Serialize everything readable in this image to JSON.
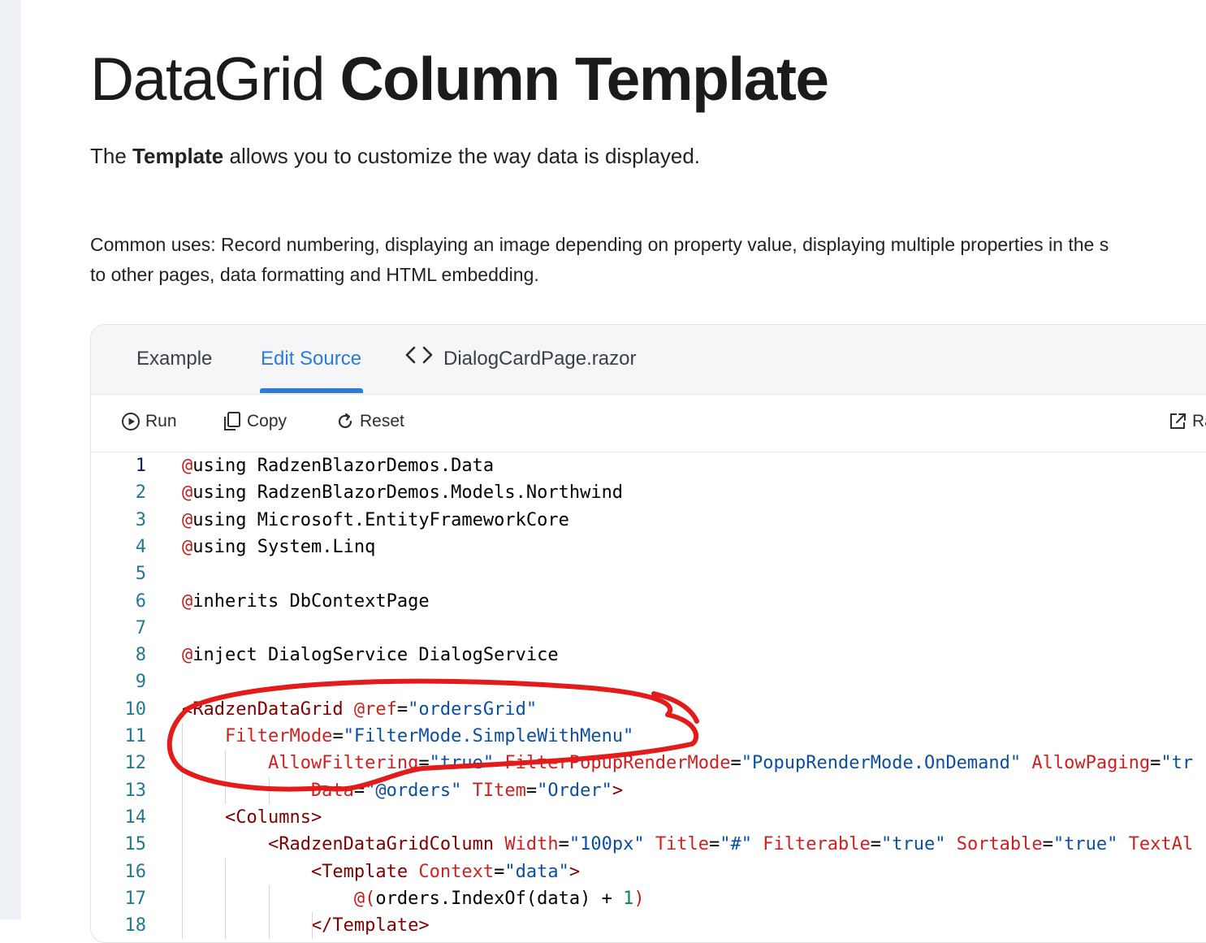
{
  "page": {
    "title_light": "DataGrid",
    "title_bold": "Column Template",
    "intro_before": "The",
    "intro_bold": "Template",
    "intro_after": "allows you to customize the way data is displayed.",
    "uses_line1": "Common uses: Record numbering, displaying an image depending on property value, displaying multiple properties in the s",
    "uses_line2": "to other pages, data formatting and HTML embedding."
  },
  "tabs": {
    "example": "Example",
    "edit_source": "Edit Source",
    "file": "DialogCardPage.razor",
    "active": "edit_source"
  },
  "toolbar": {
    "run": "Run",
    "copy": "Copy",
    "reset": "Reset",
    "external": "Ra"
  },
  "icons": {
    "run": "play-circle-icon",
    "copy": "copy-icon",
    "reset": "refresh-icon",
    "external": "external-link-icon",
    "file": "code-brackets-icon"
  },
  "colors": {
    "accent": "#2f7ad8",
    "annotation": "#e31b1b"
  },
  "code": {
    "lines": [
      {
        "n": "1",
        "tokens": [
          {
            "t": "@",
            "c": "kw"
          },
          {
            "t": "using RadzenBlazorDemos.Data",
            "c": "plain"
          }
        ]
      },
      {
        "n": "2",
        "tokens": [
          {
            "t": "@",
            "c": "kw"
          },
          {
            "t": "using RadzenBlazorDemos.Models.Northwind",
            "c": "plain"
          }
        ]
      },
      {
        "n": "3",
        "tokens": [
          {
            "t": "@",
            "c": "kw"
          },
          {
            "t": "using Microsoft.EntityFrameworkCore",
            "c": "plain"
          }
        ]
      },
      {
        "n": "4",
        "tokens": [
          {
            "t": "@",
            "c": "kw"
          },
          {
            "t": "using System.Linq",
            "c": "plain"
          }
        ]
      },
      {
        "n": "5",
        "tokens": []
      },
      {
        "n": "6",
        "tokens": [
          {
            "t": "@",
            "c": "kw"
          },
          {
            "t": "inherits DbContextPage",
            "c": "plain"
          }
        ]
      },
      {
        "n": "7",
        "tokens": []
      },
      {
        "n": "8",
        "tokens": [
          {
            "t": "@",
            "c": "kw"
          },
          {
            "t": "inject DialogService DialogService",
            "c": "plain"
          }
        ]
      },
      {
        "n": "9",
        "tokens": []
      },
      {
        "n": "10",
        "tokens": [
          {
            "t": "<RadzenDataGrid ",
            "c": "tag"
          },
          {
            "t": "@ref",
            "c": "attr"
          },
          {
            "t": "=",
            "c": "plain"
          },
          {
            "t": "\"ordersGrid\"",
            "c": "str"
          }
        ]
      },
      {
        "n": "11",
        "tokens": [
          {
            "t": "    FilterMode",
            "c": "attr"
          },
          {
            "t": "=",
            "c": "plain"
          },
          {
            "t": "\"FilterMode.SimpleWithMenu\"",
            "c": "str"
          }
        ]
      },
      {
        "n": "12",
        "tokens": [
          {
            "t": "        AllowFiltering",
            "c": "attr"
          },
          {
            "t": "=",
            "c": "plain"
          },
          {
            "t": "\"true\" ",
            "c": "str"
          },
          {
            "t": "FilterPopupRenderMode",
            "c": "attr"
          },
          {
            "t": "=",
            "c": "plain"
          },
          {
            "t": "\"PopupRenderMode.OnDemand\" ",
            "c": "str"
          },
          {
            "t": "AllowPaging",
            "c": "attr"
          },
          {
            "t": "=",
            "c": "plain"
          },
          {
            "t": "\"tr",
            "c": "str"
          }
        ]
      },
      {
        "n": "13",
        "tokens": [
          {
            "t": "            Data",
            "c": "attr"
          },
          {
            "t": "=",
            "c": "plain"
          },
          {
            "t": "\"@orders\" ",
            "c": "str"
          },
          {
            "t": "TItem",
            "c": "attr"
          },
          {
            "t": "=",
            "c": "plain"
          },
          {
            "t": "\"Order\"",
            "c": "str"
          },
          {
            "t": ">",
            "c": "tag"
          }
        ]
      },
      {
        "n": "14",
        "tokens": [
          {
            "t": "    <Columns>",
            "c": "tag"
          }
        ]
      },
      {
        "n": "15",
        "tokens": [
          {
            "t": "        <RadzenDataGridColumn ",
            "c": "tag"
          },
          {
            "t": "Width",
            "c": "attr"
          },
          {
            "t": "=",
            "c": "plain"
          },
          {
            "t": "\"100px\" ",
            "c": "str"
          },
          {
            "t": "Title",
            "c": "attr"
          },
          {
            "t": "=",
            "c": "plain"
          },
          {
            "t": "\"#\" ",
            "c": "str"
          },
          {
            "t": "Filterable",
            "c": "attr"
          },
          {
            "t": "=",
            "c": "plain"
          },
          {
            "t": "\"true\" ",
            "c": "str"
          },
          {
            "t": "Sortable",
            "c": "attr"
          },
          {
            "t": "=",
            "c": "plain"
          },
          {
            "t": "\"true\" ",
            "c": "str"
          },
          {
            "t": "TextAl",
            "c": "attr"
          }
        ]
      },
      {
        "n": "16",
        "tokens": [
          {
            "t": "            <Template ",
            "c": "tag"
          },
          {
            "t": "Context",
            "c": "attr"
          },
          {
            "t": "=",
            "c": "plain"
          },
          {
            "t": "\"data\"",
            "c": "str"
          },
          {
            "t": ">",
            "c": "tag"
          }
        ]
      },
      {
        "n": "17",
        "tokens": [
          {
            "t": "                @(",
            "c": "kw"
          },
          {
            "t": "orders.IndexOf(data) + ",
            "c": "plain"
          },
          {
            "t": "1",
            "c": "num"
          },
          {
            "t": ")",
            "c": "kw"
          }
        ]
      },
      {
        "n": "18",
        "tokens": [
          {
            "t": "            </Template>",
            "c": "tag"
          }
        ]
      }
    ]
  }
}
